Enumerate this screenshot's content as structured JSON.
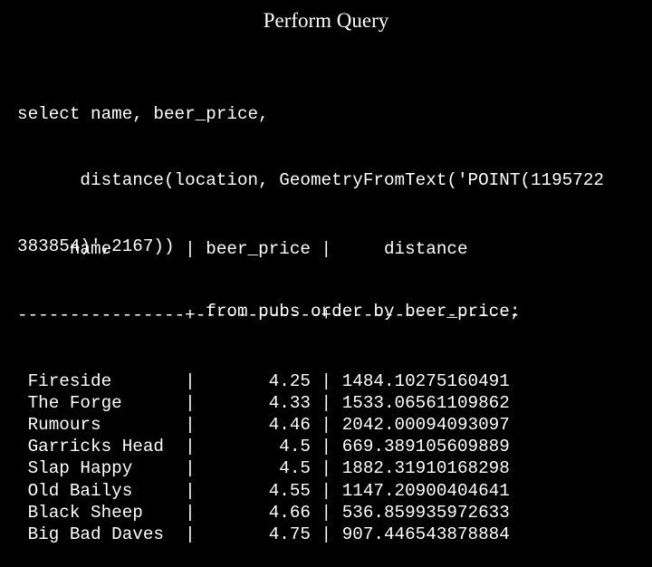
{
  "slide": {
    "title": "Perform Query"
  },
  "query": {
    "lines": [
      "select name, beer_price,",
      "      distance(location, GeometryFromText('POINT(1195722",
      "383854)',2167))",
      "                  from pubs order by beer_price;"
    ]
  },
  "result": {
    "columns": [
      "name",
      "beer_price",
      "distance"
    ],
    "header_line": "     name       | beer_price |     distance",
    "separator_line": "----------------+------------+------------------",
    "rows": [
      {
        "name": "Fireside",
        "beer_price": "4.25",
        "distance": "1484.10275160491"
      },
      {
        "name": "The Forge",
        "beer_price": "4.33",
        "distance": "1533.06561109862"
      },
      {
        "name": "Rumours",
        "beer_price": "4.46",
        "distance": "2042.00094093097"
      },
      {
        "name": "Garricks Head",
        "beer_price": "4.5",
        "distance": "669.389105609889"
      },
      {
        "name": "Slap Happy",
        "beer_price": "4.5",
        "distance": "1882.31910168298"
      },
      {
        "name": "Old Bailys",
        "beer_price": "4.55",
        "distance": "1147.20900404641"
      },
      {
        "name": "Black Sheep",
        "beer_price": "4.66",
        "distance": "536.859935972633"
      },
      {
        "name": "Big Bad Daves",
        "beer_price": "4.75",
        "distance": "907.446543878884"
      }
    ]
  }
}
